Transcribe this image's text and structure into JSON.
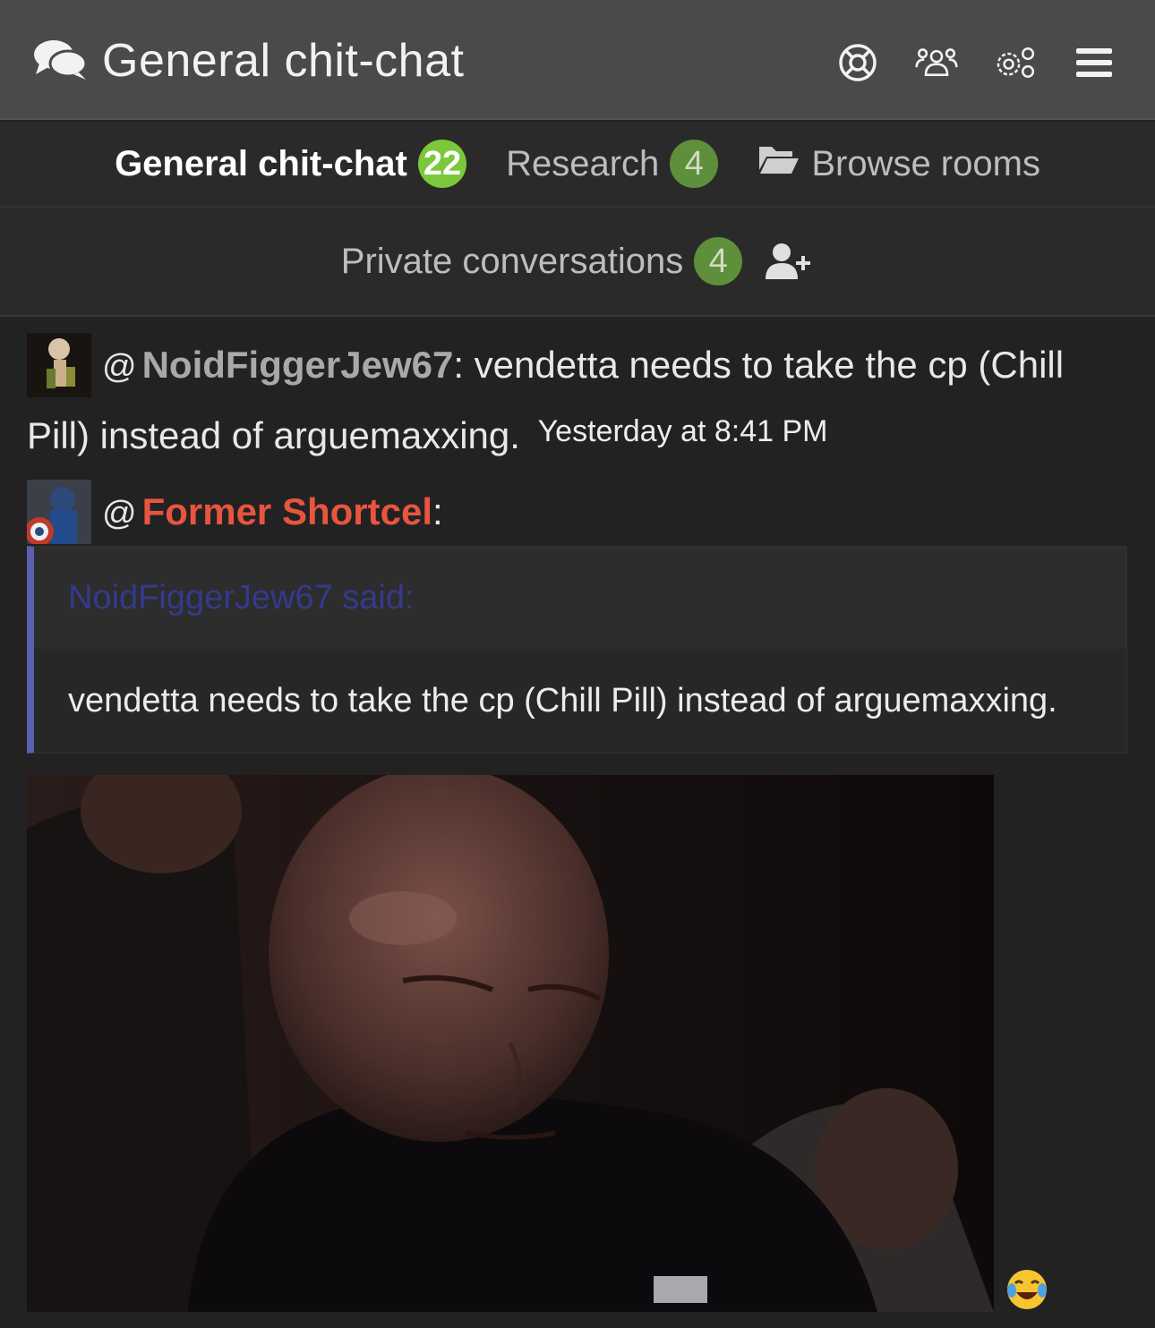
{
  "header": {
    "title": "General chit-chat",
    "icons": [
      "chat-bubbles-icon",
      "lifebuoy-icon",
      "users-icon",
      "settings-icon",
      "menu-icon"
    ]
  },
  "tabs": [
    {
      "label": "General chit-chat",
      "badge": "22",
      "active": true
    },
    {
      "label": "Research",
      "badge": "4",
      "active": false
    },
    {
      "label": "Browse rooms",
      "icon": "folder-open-icon"
    }
  ],
  "private": {
    "label": "Private conversations",
    "badge": "4",
    "icon": "user-plus-icon"
  },
  "messages": [
    {
      "at": "@",
      "user": "NoidFiggerJew67",
      "text": ": vendetta needs to take the cp (Chill Pill) instead of arguemaxxing.",
      "time": "Yesterday at 8:41 PM",
      "user_color": "#a9a9a9"
    },
    {
      "at": "@",
      "user": "Former Shortcel",
      "text": ":",
      "user_color": "#e8553f",
      "quote": {
        "author": "NoidFiggerJew67 said:",
        "body": "vendetta needs to take the cp (Chill Pill) instead of arguemaxxing."
      },
      "reaction": "face-with-tears-of-joy-icon"
    }
  ],
  "colors": {
    "accent_green": "#7bc83a",
    "dim_green": "#5e8f3a",
    "quote_border": "#5a5fb0",
    "username_red": "#e8553f"
  }
}
